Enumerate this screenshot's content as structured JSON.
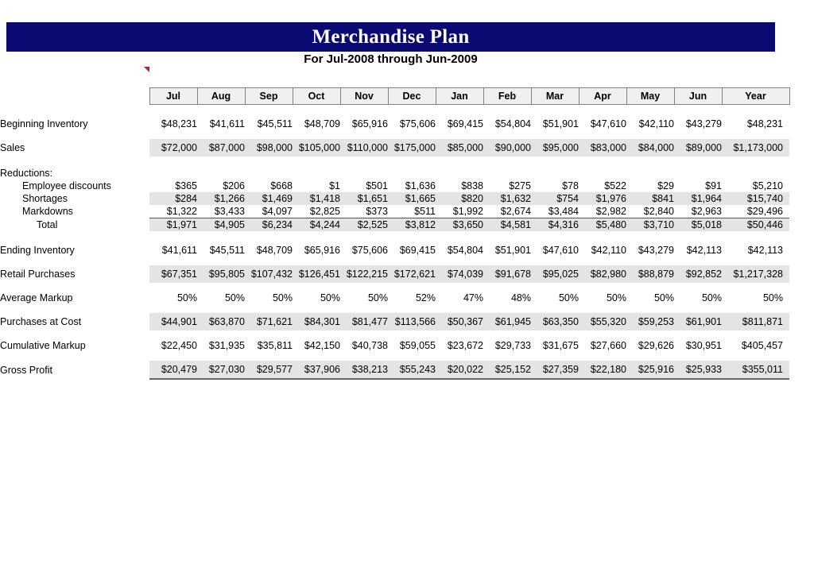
{
  "banner": {
    "title": "Merchandise Plan",
    "subtitle": "For Jul-2008 through Jun-2009",
    "navy": "#0a0a72",
    "marker": "comment-marker-icon"
  },
  "table": {
    "row_header_blank": "",
    "columns": [
      "Jul",
      "Aug",
      "Sep",
      "Oct",
      "Nov",
      "Dec",
      "Jan",
      "Feb",
      "Mar",
      "Apr",
      "May",
      "Jun",
      "Year"
    ],
    "rows": [
      {
        "label": "Beginning Inventory",
        "values": [
          "$48,231",
          "$41,611",
          "$45,511",
          "$48,709",
          "$65,916",
          "$75,606",
          "$69,415",
          "$54,804",
          "$51,901",
          "$47,610",
          "$42,110",
          "$43,279",
          "$48,231"
        ]
      },
      {
        "label": "Sales",
        "values": [
          "$72,000",
          "$87,000",
          "$98,000",
          "$105,000",
          "$110,000",
          "$175,000",
          "$85,000",
          "$90,000",
          "$95,000",
          "$83,000",
          "$84,000",
          "$89,000",
          "$1,173,000"
        ]
      },
      {
        "label": "Reductions:",
        "values": [
          "",
          "",
          "",
          "",
          "",
          "",
          "",
          "",
          "",
          "",
          "",
          "",
          ""
        ]
      },
      {
        "label": "Employee discounts",
        "values": [
          "$365",
          "$206",
          "$668",
          "$1",
          "$501",
          "$1,636",
          "$838",
          "$275",
          "$78",
          "$522",
          "$29",
          "$91",
          "$5,210"
        ]
      },
      {
        "label": "Shortages",
        "values": [
          "$284",
          "$1,266",
          "$1,469",
          "$1,418",
          "$1,651",
          "$1,665",
          "$820",
          "$1,632",
          "$754",
          "$1,976",
          "$841",
          "$1,964",
          "$15,740"
        ]
      },
      {
        "label": "Markdowns",
        "values": [
          "$1,322",
          "$3,433",
          "$4,097",
          "$2,825",
          "$373",
          "$511",
          "$1,992",
          "$2,674",
          "$3,484",
          "$2,982",
          "$2,840",
          "$2,963",
          "$29,496"
        ]
      },
      {
        "label": "Total",
        "values": [
          "$1,971",
          "$4,905",
          "$6,234",
          "$4,244",
          "$2,525",
          "$3,812",
          "$3,650",
          "$4,581",
          "$4,316",
          "$5,480",
          "$3,710",
          "$5,018",
          "$50,446"
        ]
      },
      {
        "label": "Ending Inventory",
        "values": [
          "$41,611",
          "$45,511",
          "$48,709",
          "$65,916",
          "$75,606",
          "$69,415",
          "$54,804",
          "$51,901",
          "$47,610",
          "$42,110",
          "$43,279",
          "$42,113",
          "$42,113"
        ]
      },
      {
        "label": "Retail Purchases",
        "values": [
          "$67,351",
          "$95,805",
          "$107,432",
          "$126,451",
          "$122,215",
          "$172,621",
          "$74,039",
          "$91,678",
          "$95,025",
          "$82,980",
          "$88,879",
          "$92,852",
          "$1,217,328"
        ]
      },
      {
        "label": "Average Markup",
        "values": [
          "50%",
          "50%",
          "50%",
          "50%",
          "50%",
          "52%",
          "47%",
          "48%",
          "50%",
          "50%",
          "50%",
          "50%",
          "50%"
        ]
      },
      {
        "label": "Purchases at Cost",
        "values": [
          "$44,901",
          "$63,870",
          "$71,621",
          "$84,301",
          "$81,477",
          "$113,566",
          "$50,367",
          "$61,945",
          "$63,350",
          "$55,320",
          "$59,253",
          "$61,901",
          "$811,871"
        ]
      },
      {
        "label": "Cumulative Markup",
        "values": [
          "$22,450",
          "$31,935",
          "$35,811",
          "$42,150",
          "$40,738",
          "$59,055",
          "$23,672",
          "$29,733",
          "$31,675",
          "$27,660",
          "$29,626",
          "$30,951",
          "$405,457"
        ]
      },
      {
        "label": "Gross Profit",
        "values": [
          "$20,479",
          "$27,030",
          "$29,577",
          "$37,906",
          "$38,213",
          "$55,243",
          "$20,022",
          "$25,152",
          "$27,359",
          "$22,180",
          "$25,916",
          "$25,933",
          "$355,011"
        ]
      }
    ]
  }
}
